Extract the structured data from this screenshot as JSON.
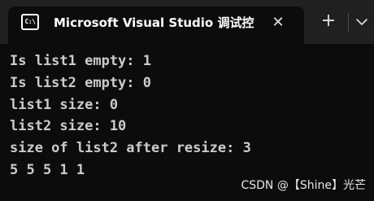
{
  "window": {
    "tab": {
      "icon": "console-app-icon",
      "icon_glyph": "C:\\",
      "title": "Microsoft Visual Studio 调试控",
      "close_glyph": "✕"
    },
    "new_tab_glyph": "+",
    "dropdown_icon": "chevron-down-icon"
  },
  "console": {
    "lines": [
      "Is list1 empty: 1",
      "Is list2 empty: 0",
      "list1 size: 0",
      "list2 size: 10",
      "size of list2 after resize: 3",
      "5 5 5 1 1"
    ]
  },
  "watermark": "CSDN @【Shine】光芒",
  "colors": {
    "titlebar": "#202020",
    "tab_background": "#0c0c0c",
    "console_background": "#0c0c0c",
    "console_text": "#cccccc",
    "title_text": "#ffffff"
  }
}
